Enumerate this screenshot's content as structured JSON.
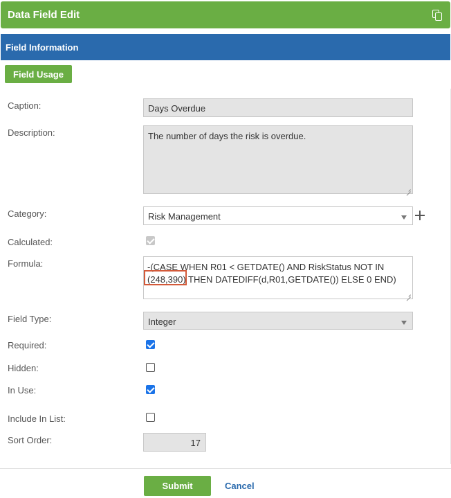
{
  "window": {
    "title": "Data Field Edit"
  },
  "section": {
    "title": "Field Information"
  },
  "buttons": {
    "field_usage": "Field Usage",
    "submit": "Submit",
    "cancel": "Cancel"
  },
  "labels": {
    "caption": "Caption:",
    "description": "Description:",
    "category": "Category:",
    "calculated": "Calculated:",
    "formula": "Formula:",
    "field_type": "Field Type:",
    "required": "Required:",
    "hidden": "Hidden:",
    "in_use": "In Use:",
    "include_in_list": "Include In List:",
    "sort_order": "Sort Order:"
  },
  "values": {
    "caption": "Days Overdue",
    "description": "The number of days the risk is overdue.",
    "category": "Risk Management",
    "formula": "-(CASE WHEN R01 < GETDATE() AND RiskStatus NOT IN (248,390) THEN DATEDIFF(d,R01,GETDATE()) ELSE 0 END)",
    "field_type": "Integer",
    "sort_order": "17",
    "calculated": true,
    "required": true,
    "hidden": false,
    "in_use": true,
    "include_in_list": false
  },
  "icons": {
    "copy": "copy-icon",
    "add": "plus-icon",
    "dropdown": "chevron-down-icon"
  },
  "colors": {
    "green": "#6aae44",
    "blue": "#2a6aad",
    "checkbox": "#1a73e8",
    "highlight": "#d35a3a"
  }
}
